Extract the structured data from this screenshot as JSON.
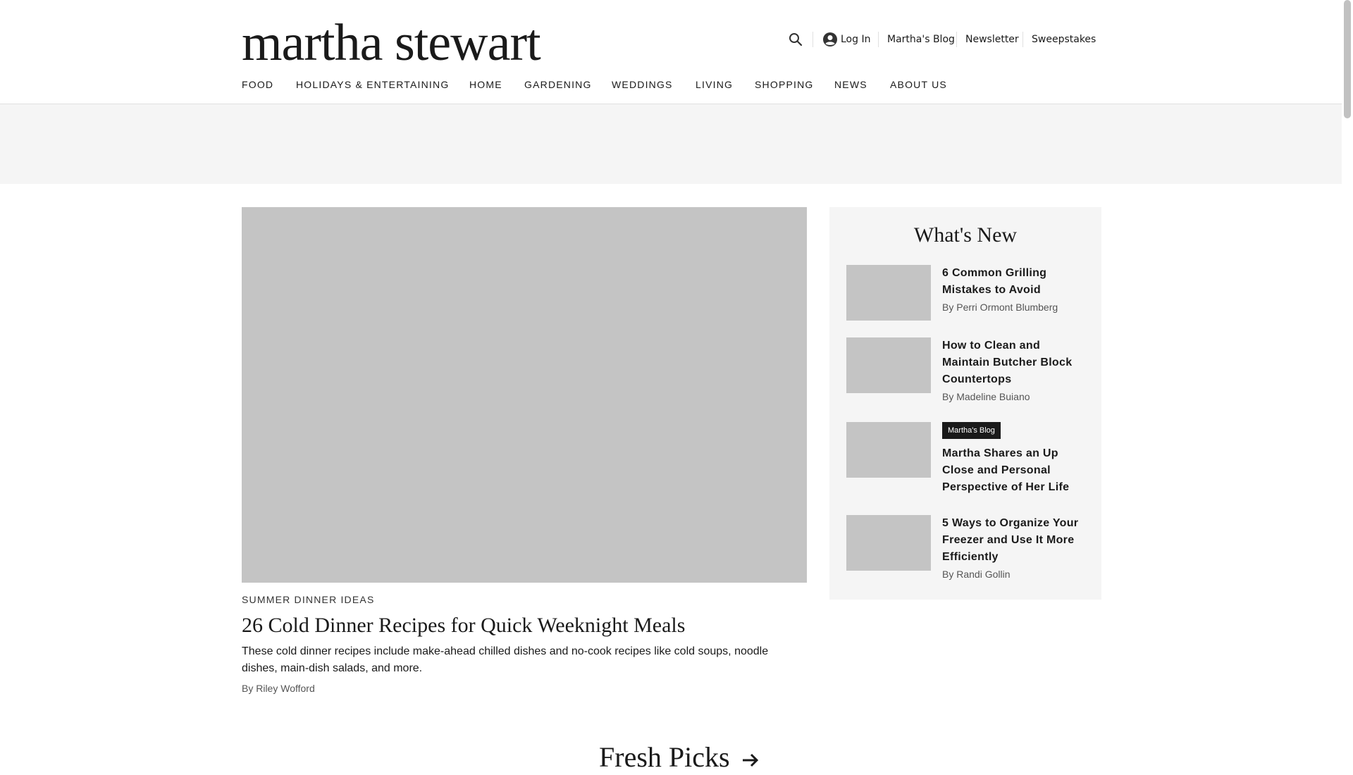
{
  "brand": {
    "logo": "martha stewart"
  },
  "utility": {
    "search_icon": "search-icon",
    "login_icon": "account-circle-icon",
    "login": "Log In",
    "links": [
      "Martha's Blog",
      "Newsletter",
      "Sweepstakes"
    ]
  },
  "nav": {
    "items": [
      "FOOD",
      "HOLIDAYS & ENTERTAINING",
      "HOME",
      "GARDENING",
      "WEDDINGS",
      "LIVING",
      "SHOPPING",
      "NEWS",
      "ABOUT US"
    ]
  },
  "hero": {
    "kicker": "SUMMER DINNER IDEAS",
    "title": "26 Cold Dinner Recipes for Quick Weeknight Meals",
    "description": "These cold dinner recipes include make-ahead chilled dishes and no-cook recipes like cold soups, noodle dishes, main-dish salads, and more.",
    "byline": "By Riley Wofford"
  },
  "whats_new": {
    "title": "What's New",
    "items": [
      {
        "title": "6 Common Grilling Mistakes to Avoid",
        "byline": "By Perri Ormont Blumberg"
      },
      {
        "title": "How to Clean and Maintain Butcher Block Countertops",
        "byline": "By Madeline Buiano"
      },
      {
        "badge": "Martha's Blog",
        "title": "Martha Shares an Up Close and Personal Perspective of Her Life"
      },
      {
        "title": "5 Ways to Organize Your Freezer and Use It More Efficiently",
        "byline": "By Randi Gollin"
      }
    ]
  },
  "fresh_picks": {
    "title": "Fresh Picks",
    "arrow_icon": "arrow-right-icon"
  },
  "colors": {
    "text": "#1a1a1a",
    "placeholder": "#c4c4c4",
    "panel": "#f5f5f5"
  }
}
